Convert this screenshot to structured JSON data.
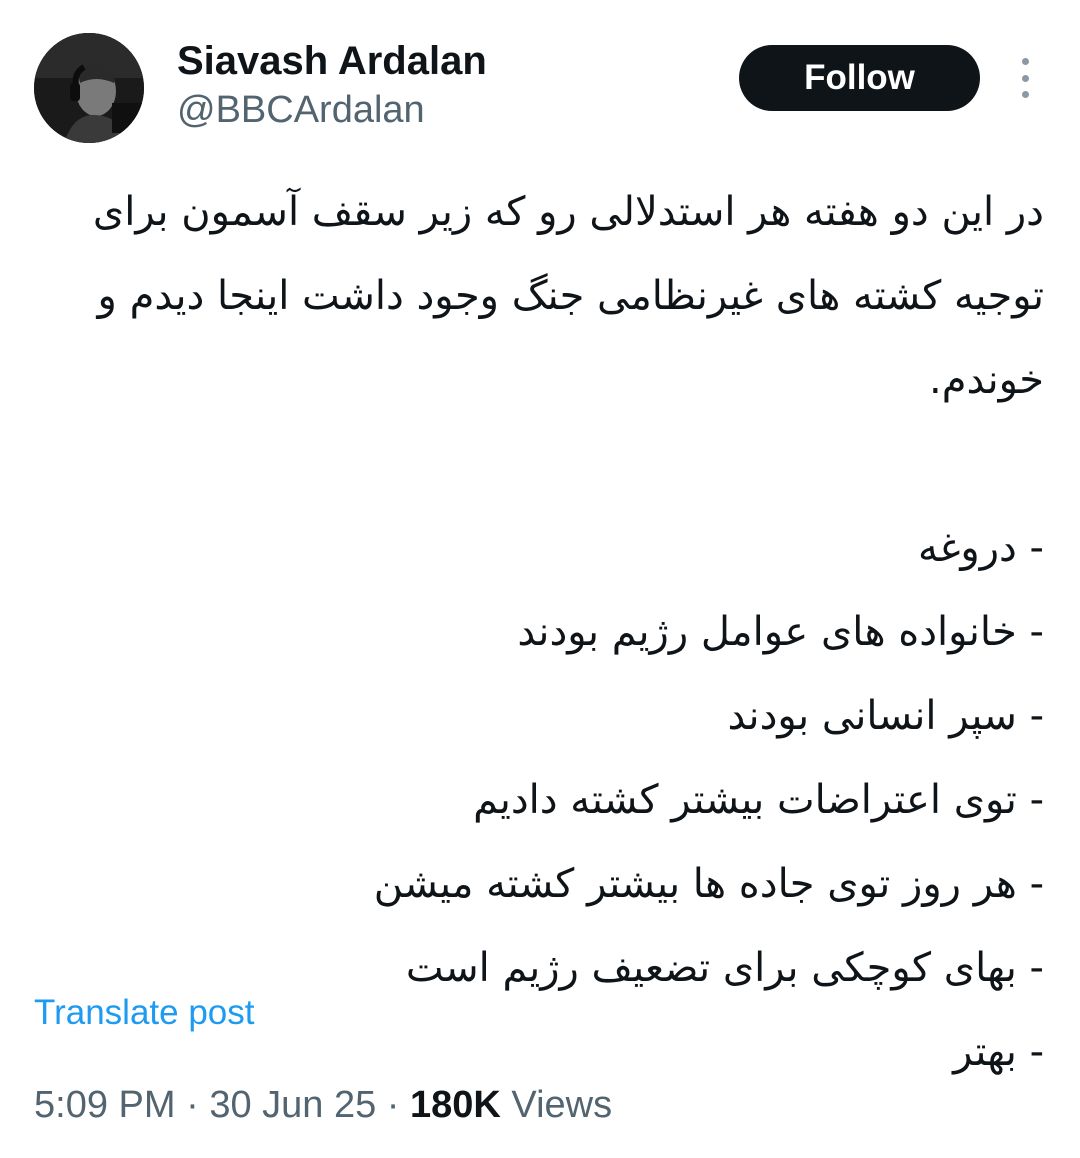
{
  "author": {
    "display_name": "Siavash Ardalan",
    "handle": "@BBCArdalan"
  },
  "actions": {
    "follow_label": "Follow",
    "more_icon": "more-vertical-icon"
  },
  "tweet": {
    "paragraph": "در این دو هفته هر استدلالی رو که زیر سقف آسمون برای توجیه کشته های غیرنظامی جنگ وجود داشت اینجا دیدم و خوندم.",
    "list_items": [
      "- دروغه",
      "- خانواده های عوامل رژیم بودند",
      "- سپر انسانی بودند",
      "- توی اعتراضات بیشتر کشته دادیم",
      "- هر روز توی جاده ها بیشتر کشته میشن",
      "- بهای کوچکی برای تضعیف رژیم است",
      "- بهتر"
    ]
  },
  "translate_label": "Translate post",
  "meta": {
    "time": "5:09 PM",
    "separator": "·",
    "date": "30 Jun 25",
    "views_count": "180K",
    "views_label": "Views"
  },
  "colors": {
    "text": "#0f1419",
    "secondary": "#536471",
    "link": "#1d9bf0",
    "button": "#0f1419"
  }
}
